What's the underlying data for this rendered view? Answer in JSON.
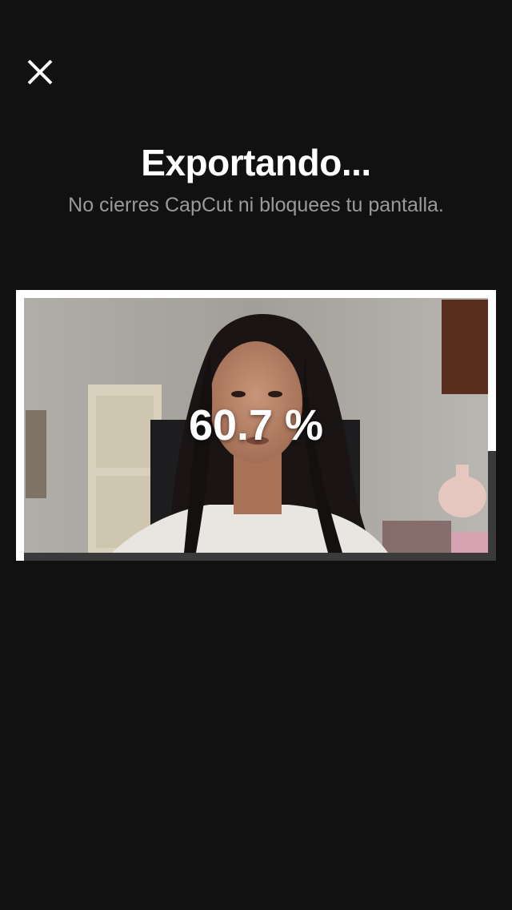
{
  "header": {
    "close_icon": "close-icon"
  },
  "export": {
    "title": "Exportando...",
    "subtitle": "No cierres CapCut ni bloquees tu pantalla.",
    "progress_label": "60.7 %",
    "progress_fraction": 0.607
  },
  "preview": {
    "description_icon": "video-thumbnail"
  },
  "colors": {
    "background": "#111111",
    "progress_active": "#ffffff",
    "progress_track": "#3a3a3a",
    "subtitle": "#9a9a9a"
  }
}
